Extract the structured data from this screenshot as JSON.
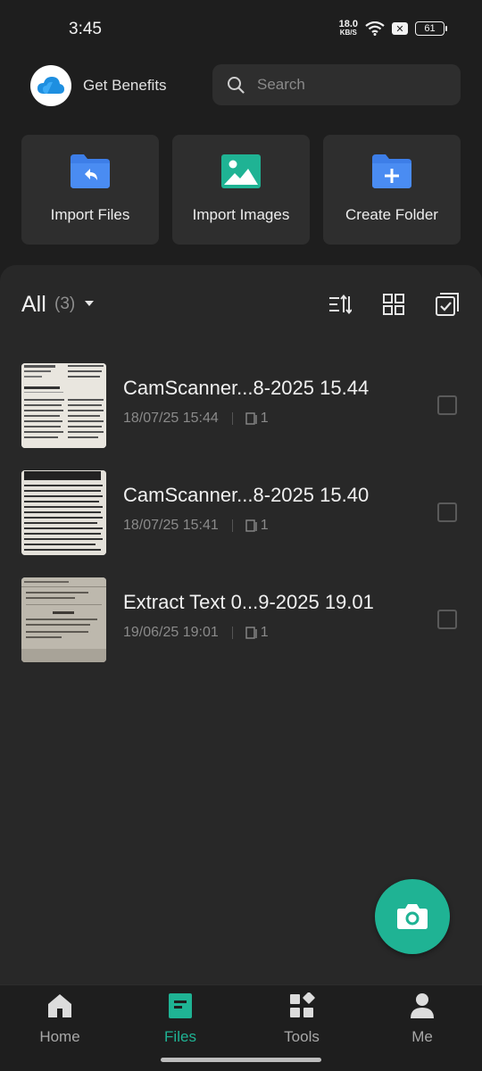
{
  "status_bar": {
    "time": "3:45",
    "net_speed_value": "18.0",
    "net_speed_unit": "KB/S",
    "battery": "61"
  },
  "header": {
    "benefits_label": "Get Benefits",
    "search_placeholder": "Search"
  },
  "actions": [
    {
      "label": "Import Files",
      "icon": "folder-import-icon"
    },
    {
      "label": "Import Images",
      "icon": "image-icon"
    },
    {
      "label": "Create Folder",
      "icon": "folder-add-icon"
    }
  ],
  "files_panel": {
    "title": "All",
    "count": "(3)"
  },
  "files": [
    {
      "name": "CamScanner...8-2025 15.44",
      "date": "18/07/25 15:44",
      "pages": "1"
    },
    {
      "name": "CamScanner...8-2025 15.40",
      "date": "18/07/25 15:41",
      "pages": "1"
    },
    {
      "name": "Extract Text 0...9-2025 19.01",
      "date": "19/06/25 19:01",
      "pages": "1"
    }
  ],
  "bottom_nav": [
    {
      "label": "Home",
      "icon": "home-icon",
      "active": false
    },
    {
      "label": "Files",
      "icon": "files-icon",
      "active": true
    },
    {
      "label": "Tools",
      "icon": "tools-icon",
      "active": false
    },
    {
      "label": "Me",
      "icon": "person-icon",
      "active": false
    }
  ],
  "colors": {
    "accent": "#1fb394",
    "folder_blue": "#3d7ee8",
    "image_teal": "#1fb394"
  }
}
